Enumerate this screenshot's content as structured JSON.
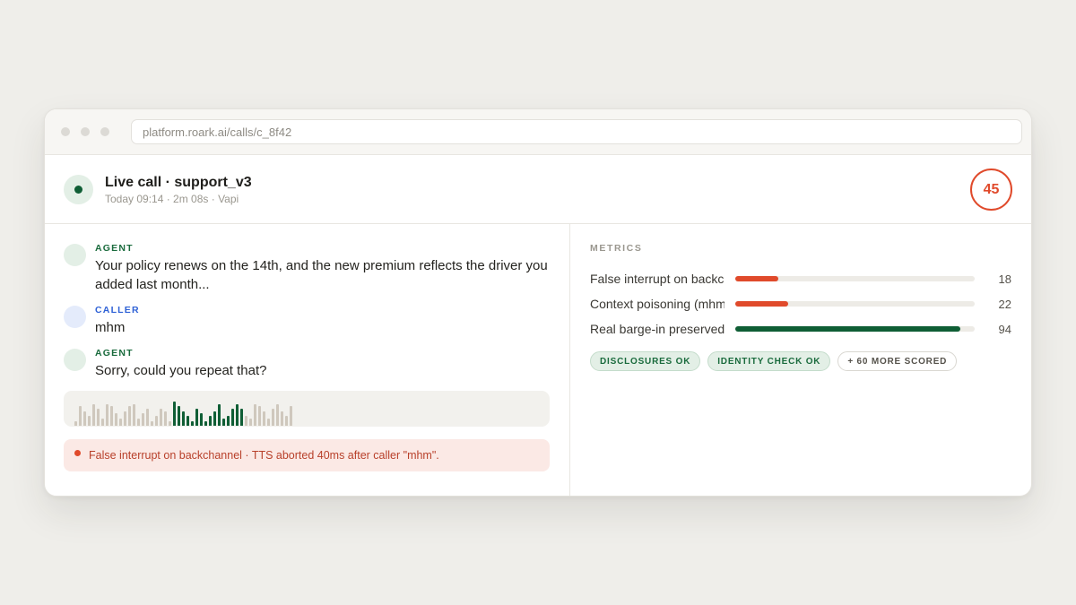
{
  "browser": {
    "url": "platform.roark.ai/calls/c_8f42"
  },
  "call": {
    "title": "Live call · support_v3",
    "subtitle": "Today 09:14 · 2m 08s · Vapi",
    "score": "45"
  },
  "transcript": [
    {
      "role": "AGENT",
      "speaker": "agent",
      "text": "Your policy renews on the 14th, and the new premium reflects the driver you added last month..."
    },
    {
      "role": "CALLER",
      "speaker": "caller",
      "text": "mhm"
    },
    {
      "role": "AGENT",
      "speaker": "agent",
      "text": "Sorry, could you repeat that?"
    }
  ],
  "waveform": {
    "levels": [
      0.2,
      0.8,
      0.6,
      0.4,
      0.9,
      0.7,
      0.3,
      0.9,
      0.8,
      0.5,
      0.3,
      0.6,
      0.8,
      0.9,
      0.3,
      0.5,
      0.7,
      0.2,
      0.4,
      0.7,
      0.6,
      0.2,
      1.0,
      0.8,
      0.6,
      0.4,
      0.2,
      0.7,
      0.5,
      0.2,
      0.4,
      0.6,
      0.9,
      0.3,
      0.4,
      0.7,
      0.9,
      0.7,
      0.4,
      0.3,
      0.9,
      0.8,
      0.6,
      0.3,
      0.7,
      0.9,
      0.6,
      0.4,
      0.8
    ],
    "highlight_range": [
      22,
      37
    ],
    "color_muted": "#cfc8bd",
    "color_active": "#0f5e35"
  },
  "alert": {
    "text": "False interrupt on backchannel · TTS aborted 40ms after caller \"mhm\"."
  },
  "metrics": {
    "title": "METRICS",
    "items": [
      {
        "label": "False interrupt on backchannel",
        "value": 18,
        "color": "#e04a2b"
      },
      {
        "label": "Context poisoning (mhm)",
        "value": 22,
        "color": "#e04a2b"
      },
      {
        "label": "Real barge-in preserved",
        "value": 94,
        "color": "#0f5e35"
      }
    ],
    "chips": [
      {
        "label": "DISCLOSURES OK",
        "kind": "ok"
      },
      {
        "label": "IDENTITY CHECK OK",
        "kind": "ok"
      },
      {
        "label": "+ 60 MORE SCORED",
        "kind": "more"
      }
    ]
  }
}
